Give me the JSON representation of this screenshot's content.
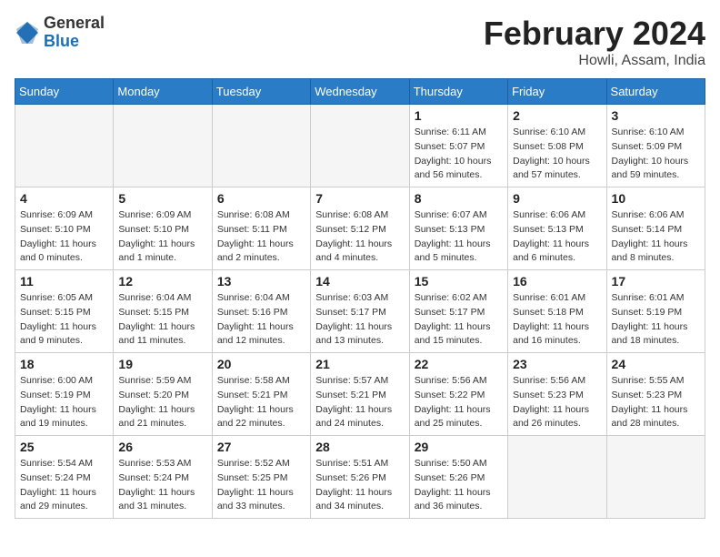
{
  "header": {
    "logo_general": "General",
    "logo_blue": "Blue",
    "month_year": "February 2024",
    "location": "Howli, Assam, India"
  },
  "days_of_week": [
    "Sunday",
    "Monday",
    "Tuesday",
    "Wednesday",
    "Thursday",
    "Friday",
    "Saturday"
  ],
  "weeks": [
    [
      {
        "day": "",
        "empty": true
      },
      {
        "day": "",
        "empty": true
      },
      {
        "day": "",
        "empty": true
      },
      {
        "day": "",
        "empty": true
      },
      {
        "day": "1",
        "sunrise": "6:11 AM",
        "sunset": "5:07 PM",
        "daylight": "10 hours and 56 minutes."
      },
      {
        "day": "2",
        "sunrise": "6:10 AM",
        "sunset": "5:08 PM",
        "daylight": "10 hours and 57 minutes."
      },
      {
        "day": "3",
        "sunrise": "6:10 AM",
        "sunset": "5:09 PM",
        "daylight": "10 hours and 59 minutes."
      }
    ],
    [
      {
        "day": "4",
        "sunrise": "6:09 AM",
        "sunset": "5:10 PM",
        "daylight": "11 hours and 0 minutes."
      },
      {
        "day": "5",
        "sunrise": "6:09 AM",
        "sunset": "5:10 PM",
        "daylight": "11 hours and 1 minute."
      },
      {
        "day": "6",
        "sunrise": "6:08 AM",
        "sunset": "5:11 PM",
        "daylight": "11 hours and 2 minutes."
      },
      {
        "day": "7",
        "sunrise": "6:08 AM",
        "sunset": "5:12 PM",
        "daylight": "11 hours and 4 minutes."
      },
      {
        "day": "8",
        "sunrise": "6:07 AM",
        "sunset": "5:13 PM",
        "daylight": "11 hours and 5 minutes."
      },
      {
        "day": "9",
        "sunrise": "6:06 AM",
        "sunset": "5:13 PM",
        "daylight": "11 hours and 6 minutes."
      },
      {
        "day": "10",
        "sunrise": "6:06 AM",
        "sunset": "5:14 PM",
        "daylight": "11 hours and 8 minutes."
      }
    ],
    [
      {
        "day": "11",
        "sunrise": "6:05 AM",
        "sunset": "5:15 PM",
        "daylight": "11 hours and 9 minutes."
      },
      {
        "day": "12",
        "sunrise": "6:04 AM",
        "sunset": "5:15 PM",
        "daylight": "11 hours and 11 minutes."
      },
      {
        "day": "13",
        "sunrise": "6:04 AM",
        "sunset": "5:16 PM",
        "daylight": "11 hours and 12 minutes."
      },
      {
        "day": "14",
        "sunrise": "6:03 AM",
        "sunset": "5:17 PM",
        "daylight": "11 hours and 13 minutes."
      },
      {
        "day": "15",
        "sunrise": "6:02 AM",
        "sunset": "5:17 PM",
        "daylight": "11 hours and 15 minutes."
      },
      {
        "day": "16",
        "sunrise": "6:01 AM",
        "sunset": "5:18 PM",
        "daylight": "11 hours and 16 minutes."
      },
      {
        "day": "17",
        "sunrise": "6:01 AM",
        "sunset": "5:19 PM",
        "daylight": "11 hours and 18 minutes."
      }
    ],
    [
      {
        "day": "18",
        "sunrise": "6:00 AM",
        "sunset": "5:19 PM",
        "daylight": "11 hours and 19 minutes."
      },
      {
        "day": "19",
        "sunrise": "5:59 AM",
        "sunset": "5:20 PM",
        "daylight": "11 hours and 21 minutes."
      },
      {
        "day": "20",
        "sunrise": "5:58 AM",
        "sunset": "5:21 PM",
        "daylight": "11 hours and 22 minutes."
      },
      {
        "day": "21",
        "sunrise": "5:57 AM",
        "sunset": "5:21 PM",
        "daylight": "11 hours and 24 minutes."
      },
      {
        "day": "22",
        "sunrise": "5:56 AM",
        "sunset": "5:22 PM",
        "daylight": "11 hours and 25 minutes."
      },
      {
        "day": "23",
        "sunrise": "5:56 AM",
        "sunset": "5:23 PM",
        "daylight": "11 hours and 26 minutes."
      },
      {
        "day": "24",
        "sunrise": "5:55 AM",
        "sunset": "5:23 PM",
        "daylight": "11 hours and 28 minutes."
      }
    ],
    [
      {
        "day": "25",
        "sunrise": "5:54 AM",
        "sunset": "5:24 PM",
        "daylight": "11 hours and 29 minutes."
      },
      {
        "day": "26",
        "sunrise": "5:53 AM",
        "sunset": "5:24 PM",
        "daylight": "11 hours and 31 minutes."
      },
      {
        "day": "27",
        "sunrise": "5:52 AM",
        "sunset": "5:25 PM",
        "daylight": "11 hours and 33 minutes."
      },
      {
        "day": "28",
        "sunrise": "5:51 AM",
        "sunset": "5:26 PM",
        "daylight": "11 hours and 34 minutes."
      },
      {
        "day": "29",
        "sunrise": "5:50 AM",
        "sunset": "5:26 PM",
        "daylight": "11 hours and 36 minutes."
      },
      {
        "day": "",
        "empty": true
      },
      {
        "day": "",
        "empty": true
      }
    ]
  ],
  "labels": {
    "sunrise_prefix": "Sunrise: ",
    "sunset_prefix": "Sunset: ",
    "daylight_prefix": "Daylight: "
  }
}
